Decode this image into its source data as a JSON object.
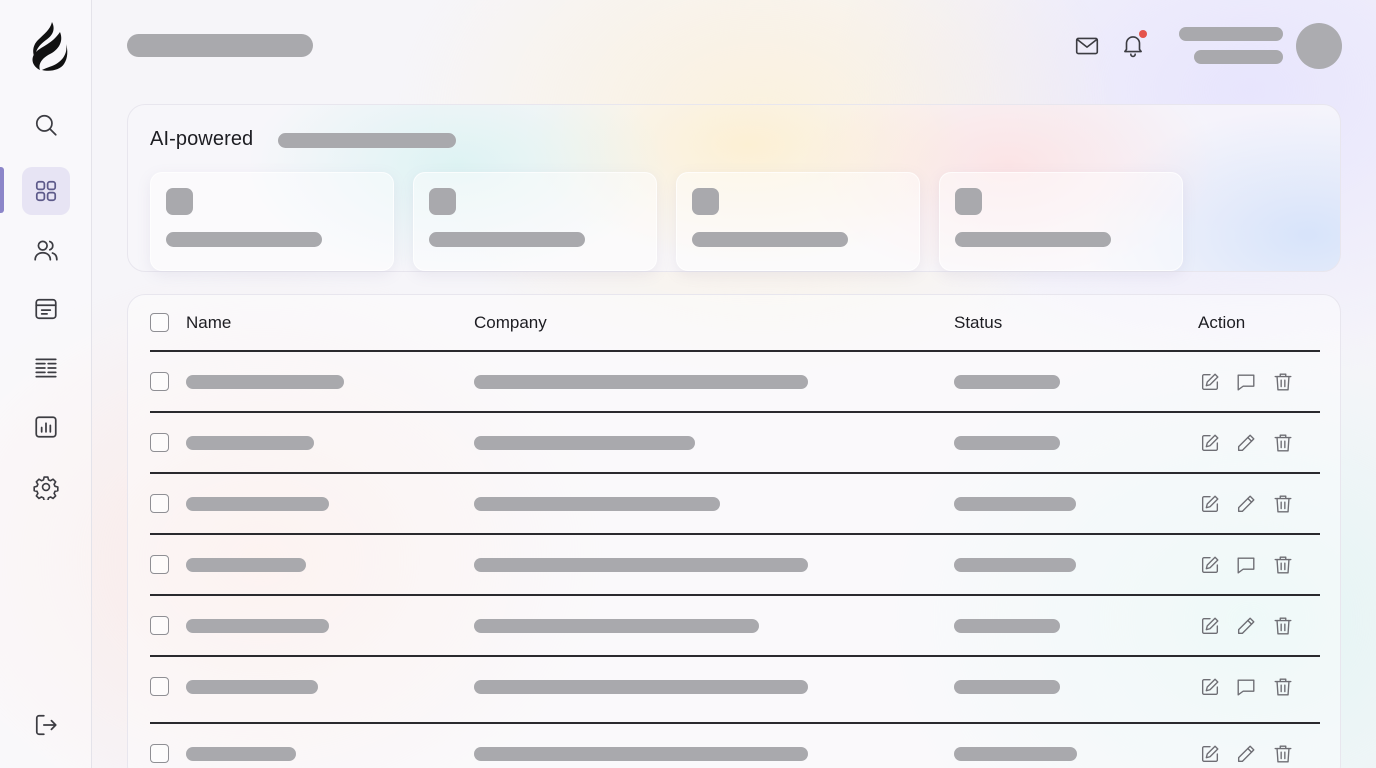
{
  "header": {
    "icons": [
      "mail-icon",
      "bell-icon"
    ],
    "notification_dot_color": "#e5534b"
  },
  "sidebar": {
    "items": [
      {
        "name": "search",
        "icon": "search-icon",
        "active": false
      },
      {
        "name": "dashboard",
        "icon": "grid-icon",
        "active": true
      },
      {
        "name": "users",
        "icon": "users-icon",
        "active": false
      },
      {
        "name": "inbox",
        "icon": "archive-icon",
        "active": false
      },
      {
        "name": "list",
        "icon": "list-icon",
        "active": false
      },
      {
        "name": "reports",
        "icon": "bar-chart-icon",
        "active": false
      },
      {
        "name": "settings",
        "icon": "gear-icon",
        "active": false
      }
    ],
    "logout_icon": "logout-icon",
    "accent": "#8c86c9"
  },
  "ai_panel": {
    "title": "AI-powered",
    "card_count": 4
  },
  "table": {
    "columns": [
      "Name",
      "Company",
      "Status",
      "Action"
    ],
    "rows": [
      {
        "actions": [
          "edit-icon",
          "comment-icon",
          "trash-icon"
        ]
      },
      {
        "actions": [
          "edit-icon",
          "pencil-icon",
          "trash-icon"
        ]
      },
      {
        "actions": [
          "edit-icon",
          "pencil-icon",
          "trash-icon"
        ]
      },
      {
        "actions": [
          "edit-icon",
          "comment-icon",
          "trash-icon"
        ]
      },
      {
        "actions": [
          "edit-icon",
          "pencil-icon",
          "trash-icon"
        ]
      },
      {
        "actions": [
          "edit-icon",
          "comment-icon",
          "trash-icon"
        ]
      },
      {
        "actions": [
          "edit-icon",
          "pencil-icon",
          "trash-icon"
        ]
      }
    ]
  }
}
